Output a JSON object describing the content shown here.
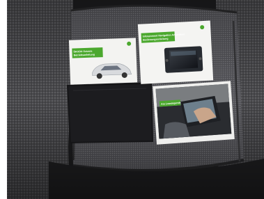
{
  "photo": {
    "subject": "car-seat-with-owner-manuals",
    "booklets": [
      {
        "id": "manual-left",
        "title_line1": "ŠKODA Octavia",
        "title_line2": "Betriebsanleitung"
      },
      {
        "id": "manual-center",
        "title_line1": "Infotainment Navigation Amundsen",
        "title_line2": "Bedienungsanleitung"
      },
      {
        "id": "manual-right",
        "badge": "Am Leasingende"
      }
    ],
    "colors": {
      "seat_dark": "#2b2b2d",
      "seat_fabric": "#4a4a4d",
      "skoda_green": "#4ba82e",
      "paper": "#f4f4f2"
    }
  }
}
